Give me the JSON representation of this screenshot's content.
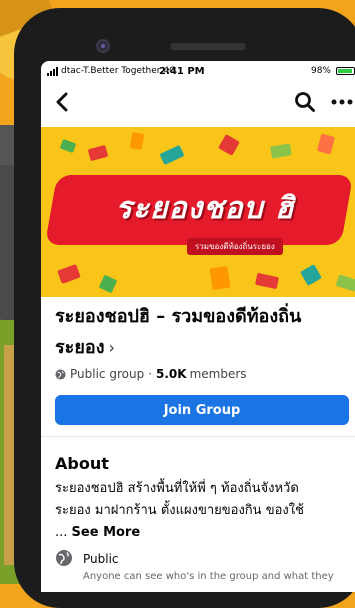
{
  "status_bar": {
    "carrier": "dtac-T.Better Together",
    "network": "4G",
    "time": "2:41 PM",
    "battery": "98%"
  },
  "nav": {
    "back_icon": "chevron-left-icon",
    "search_icon": "search-icon",
    "more_icon": "more-dots-icon"
  },
  "cover": {
    "title": "ระยองชอบ ฮิ",
    "subtitle": "รวมของดีท้องถิ่นระยอง"
  },
  "group": {
    "name_line1": "ระยองชอปฮิ – รวมของดีท้องถิ่น",
    "name_line2": "ระยอง",
    "chevron": "›",
    "privacy_label": "Public group",
    "separator": "·",
    "members_count": "5.0K",
    "members_label": "members",
    "join_label": "Join Group"
  },
  "about": {
    "title": "About",
    "text_line1": "ระยองชอปฮิ สร้างพื้นที่ให้พี่ ๆ ท้องถิ่นจังหวัด",
    "text_line2": "ระยอง มาฝากร้าน ตั้งแผงขายของกิน ของใช้",
    "ellipsis": "...",
    "see_more": "See More",
    "privacy_title": "Public",
    "privacy_desc": "Anyone can see who's in the group and what they"
  },
  "colors": {
    "accent": "#1b74e4",
    "cover_bg": "#f9c518",
    "cover_ribbon": "#e51a2b",
    "background": "#f2a41c"
  }
}
